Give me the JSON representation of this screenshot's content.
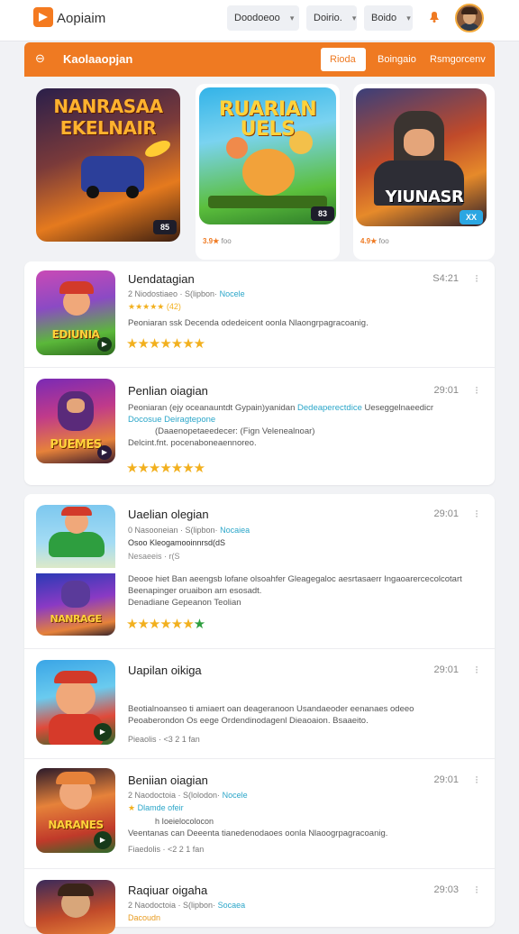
{
  "header": {
    "app_name": "Aopiaim",
    "buttons": [
      {
        "label": "Doodoeoo",
        "has_chevron": true
      },
      {
        "label": "Doirio.",
        "has_chevron": true
      },
      {
        "label": "Boido",
        "has_chevron": true
      }
    ],
    "icons": [
      "logo-icon",
      "bell-icon",
      "avatar"
    ]
  },
  "section_bar": {
    "title": "Kaolaaopjan",
    "tabs": [
      {
        "label": "Rioda",
        "active": true
      },
      {
        "label": "Boingaio",
        "active": false
      },
      {
        "label": "Rsmgorcenv",
        "active": false
      }
    ],
    "accent": "#ef7a22"
  },
  "featured": [
    {
      "title_art": "NANRASAA EKELNAIR",
      "score": "85",
      "meta": ""
    },
    {
      "title_art": "RUARIAN UELS",
      "score": "83",
      "meta_rating": "3.9",
      "meta_text": "foo"
    },
    {
      "title_art": "YIUNASR",
      "score": "XX",
      "meta_rating": "4.9",
      "meta_text": "foo"
    }
  ],
  "list_top": [
    {
      "title": "Uendatagian",
      "time": "S4:21",
      "meta": "2  Niodostiaeo  ·  S(lipbon·",
      "meta_link": "Nocele",
      "rating_line": "★★★★★  (42)",
      "desc": "Peoniaran ssk Decenda odedeicent oonla Nlaongrpagracoanig.",
      "desc_link": "",
      "stars": 7,
      "green_star": false,
      "art": "EDIUNIA"
    },
    {
      "title": "Penlian oiagian",
      "time": "29:01",
      "meta": "",
      "meta_link": "",
      "rating_line": "",
      "desc": "Peoniaran (ejy oceanauntdt Gypain)yanidan",
      "desc_link": "Dedeaperectdice",
      "desc_tail": " Ueseggelnaeedicr",
      "desc2_link": "Docosue Deiragtepone",
      "desc3": "(Daaenopetaeedecer: (Fign Velenealnoar)",
      "desc4": "Delcint.fnt. pocenaboneaennoreo.",
      "stars": 7,
      "green_star": false,
      "art": "PUEMES"
    }
  ],
  "list_bottom": [
    {
      "title": "Uaelian olegian",
      "time": "29:01",
      "meta": "0  Nasooneian  ·  S(lipbon·",
      "meta_link": "Nocaiea",
      "rating_line2": "Osoo  Kleogamooinnrsd(dS",
      "rating_line": "Nesaeeis  ·  r(S",
      "desc": "Deooe hiet Ban aeengsb lofane olsoahfer Gleagegaloc aesrtasaerr Ingaoarercecolcotart",
      "desc2": "Beenapinger oruaibon arn esosadt.",
      "desc3": "Denadiane Gepeanon Teolian",
      "stars": 7,
      "green_star": true,
      "art": "NANRAGE"
    },
    {
      "title": "Uapilan oikiga",
      "time": "29:01",
      "meta": "",
      "meta_link": "",
      "desc": "Beotialnoanseo ti amiaert oan deageranoon Usandaeoder eenanaes odeeo",
      "desc2": "Peoaberondon Os eege  Ordendinodagenl Dieaoaion. Bsaaeito.",
      "footer": "Pieaolis  ·  <3  2  1 fan",
      "stars": 0,
      "green_star": false,
      "art": ""
    },
    {
      "title": "Beniian oiagian",
      "time": "29:01",
      "meta": "2  Naodoctoia  ·  S(lolodon·",
      "meta_link": "Nocele",
      "rating_line": "Dlamde ofeir",
      "desc_pre": "h   Ioeielocolocon",
      "desc": "Veentanas can Deeenta tianedenodaoes oonla Nlaoogrpagracoanig.",
      "footer": "Fiaedolis  ·  <2  2  1 fan",
      "stars": 0,
      "green_star": false,
      "art": "NARANES"
    },
    {
      "title": "Raqiuar oigaha",
      "time": "29:03",
      "meta": "2  Naodoctoia  ·  S(lipbon·",
      "meta_link": "Socaea",
      "rating_line": "Dacoudn",
      "stars": 0,
      "green_star": false,
      "art": ""
    }
  ]
}
